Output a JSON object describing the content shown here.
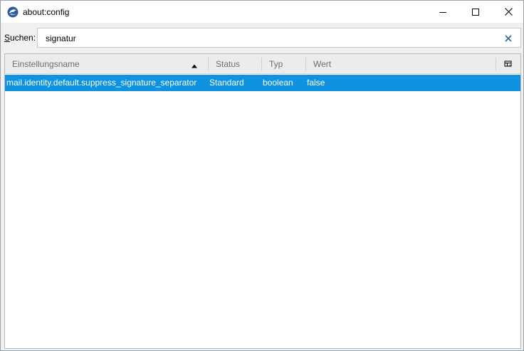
{
  "window": {
    "title": "about:config",
    "icon": "thunderbird-logo-icon"
  },
  "search": {
    "label_accel": "S",
    "label_rest": "uchen:",
    "value": "signatur",
    "placeholder": ""
  },
  "table": {
    "columns": [
      "Einstellungsname",
      "Status",
      "Typ",
      "Wert"
    ],
    "sort_column": "Einstellungsname",
    "rows": [
      {
        "name": "mail.identity.default.suppress_signature_separator",
        "status": "Standard",
        "type": "boolean",
        "value": "false",
        "selected": true
      }
    ]
  },
  "colors": {
    "selection": "#0f93e0",
    "header_bg": "#ececec",
    "window_bg": "#f0f0f0"
  }
}
